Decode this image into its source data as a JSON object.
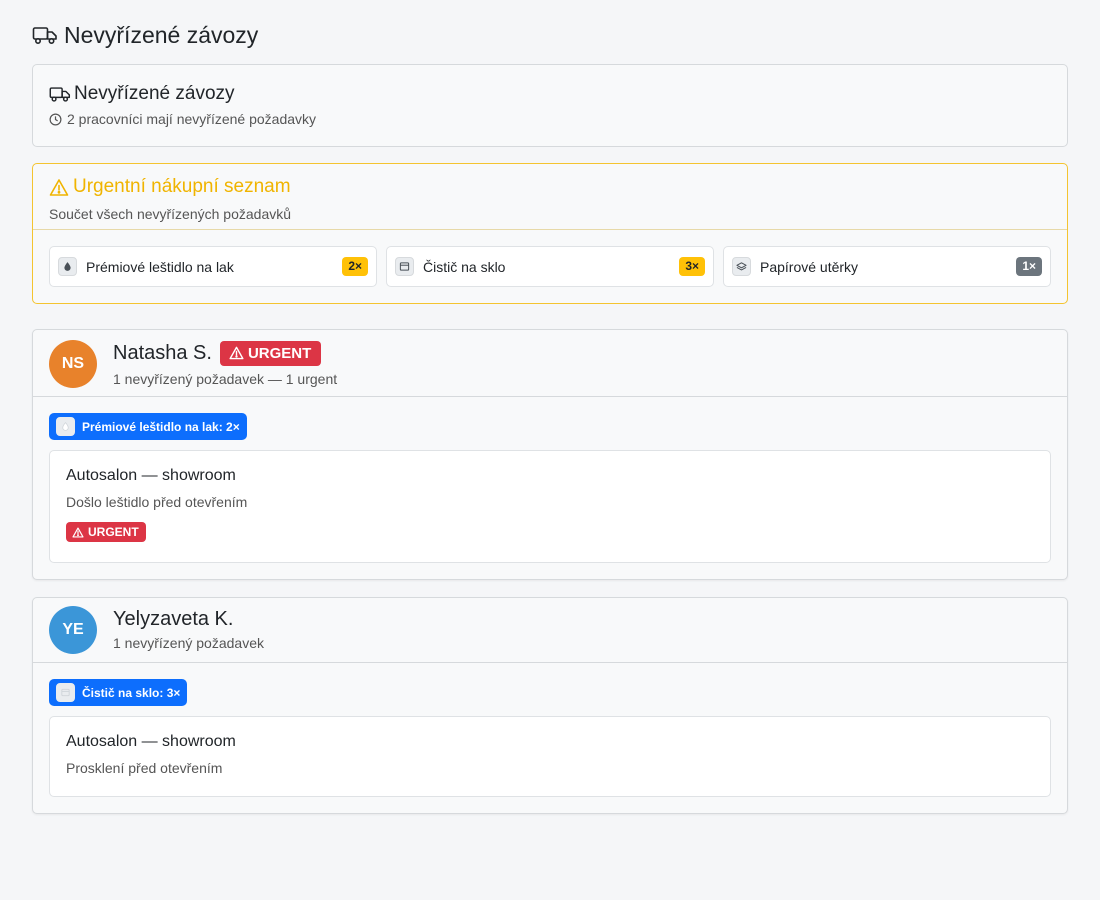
{
  "page": {
    "title": "Nevyřízené závozy"
  },
  "summary": {
    "title": "Nevyřízené závozy",
    "subtitle": "2 pracovníci mají nevyřízené požadavky"
  },
  "shopping": {
    "title": "Urgentní nákupní seznam",
    "subtitle": "Součet všech nevyřízených požadavků",
    "items": [
      {
        "label": "Prémiové leštidlo na lak",
        "qty": "2×",
        "icon": "drop-icon",
        "badge_color": "#ffc107"
      },
      {
        "label": "Čistič na sklo",
        "qty": "3×",
        "icon": "window-icon",
        "badge_color": "#ffc107"
      },
      {
        "label": "Papírové utěrky",
        "qty": "1×",
        "icon": "layers-icon",
        "badge_color": "#6c757d"
      }
    ]
  },
  "workers": [
    {
      "initials": "NS",
      "avatar_color": "#e8822b",
      "name": "Natasha S.",
      "urgent_label": "URGENT",
      "summary": "1 nevyřízený požadavek — 1 urgent",
      "tag": "Prémiové leštidlo na lak: 2×",
      "request": {
        "location": "Autosalon — showroom",
        "note": "Došlo leštidlo před otevřením",
        "badge": "URGENT"
      }
    },
    {
      "initials": "YE",
      "avatar_color": "#3b96d8",
      "name": "Yelyzaveta K.",
      "summary": "1 nevyřízený požadavek",
      "tag": "Čistič na sklo: 3×",
      "request": {
        "location": "Autosalon — showroom",
        "note": "Prosklení před otevřením"
      }
    }
  ],
  "colors": {
    "accent": "#0d6efd",
    "warning": "#ffc107",
    "danger": "#dc3545"
  }
}
